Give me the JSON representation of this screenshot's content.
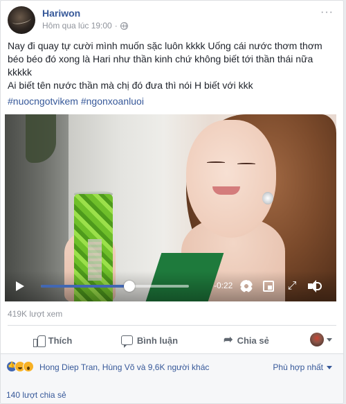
{
  "post": {
    "author": "Hariwon",
    "timestamp": "Hôm qua lúc 19:00",
    "separator": "·",
    "privacy_icon": "globe-icon",
    "more": "···",
    "text_line1": "Nay đi quay tự cười mình muốn sặc luôn kkkk Uống cái nước thơm thơm béo béo đó xong là Hari như thần kinh chứ không biết tới thần thái nữa kkkkk",
    "text_line2": "Ai biết tên nước thần mà chị đó đưa thì nói H biết với kkk",
    "hashtags": "#nuocngotvikem #ngonxoanluoi"
  },
  "video": {
    "time_remaining": "-0:22",
    "progress": 0.6,
    "fullscreen_glyph": "⤢"
  },
  "stats": {
    "views": "419K lượt xem",
    "reaction_names": "Hong Diep Tran, Hùng Võ và 9,6K người khác",
    "sort_label": "Phù hợp nhất",
    "shares": "140 lượt chia sẻ"
  },
  "actions": {
    "like": "Thích",
    "comment": "Bình luận",
    "share": "Chia sẻ",
    "share_glyph": "➦"
  },
  "colors": {
    "link": "#365899",
    "accent": "#4267b2",
    "muted": "#90949c"
  }
}
